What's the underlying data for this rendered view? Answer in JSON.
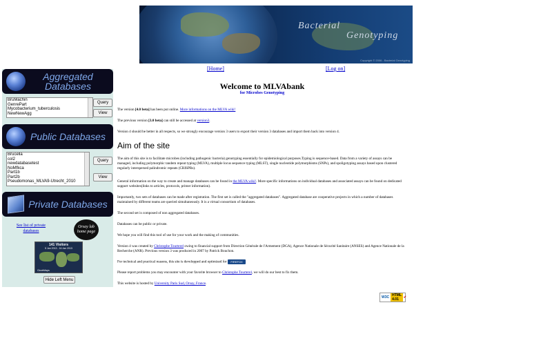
{
  "banner": {
    "word1": "Bacterial",
    "word2": "Genotyping",
    "copyright": "Copyright © 2006 - Bacterial Genotyping"
  },
  "nav": {
    "home": "[Home]",
    "login": "[Log on]"
  },
  "left_menu": {
    "aggregated": {
      "title": "Aggregated Databases",
      "items": [
        "BruMachin",
        "GenrePart",
        "Mycobacterium_tuberculosis",
        "NewNewAgg"
      ],
      "query_label": "Query",
      "view_label": "View"
    },
    "public": {
      "title": "Public Databases",
      "items": [
        "Brucella",
        "col2",
        "newdatabasetest",
        "NoMfkca",
        "Part1b",
        "Part2b",
        "Pseudomonas_MLVA9-Utrecht_2010"
      ],
      "query_label": "Query",
      "view_label": "View"
    },
    "private": {
      "title": "Private Databases",
      "see_list": "See list of private databases",
      "orsay_logo": "Orsay lab home page",
      "visitors_count": "141 Visitors",
      "visitors_dates": "5 Jan 2013 - 16 Jan 2013",
      "clustrmaps": "ClustrMaps"
    },
    "hide_label": "Hide Left Menu"
  },
  "main": {
    "title": "Welcome to MLVAbank",
    "subtitle": "for Microbes Genotyping",
    "p1_a": "The version ",
    "p1_bold": "[4.0 beta]",
    "p1_b": " has been put online. ",
    "p1_link": "More informations on the MLVA wiki!",
    "p2_a": "The previous version ",
    "p2_bold": "[3.0 beta]",
    "p2_b": " can still be accessed at ",
    "p2_link": "version3",
    "p2_c": ".",
    "p3": "Version 4 should be better in all respects, so we strongly encourage version 3 users to export their version 3 databases and import them back into version 4.",
    "aim_heading": "Aim of the site",
    "p4": "The aim of this site is to facilitate microbes (including pathogenic bacteria) genotyping essentially for epidemiological purposes.Typing is sequence-based. Data from a variety of assays can be managed, including polymorphic tandem repeat typing (MLVA), multiple locus sequence typing (MLST), single nucleotide polymorphisms (SNPs), and spoligotyping assays based upon clustered regularly interspersed palindromic repeats (CRISPRs).",
    "p5_a": "General information on the way to create and manage databases can be found in ",
    "p5_link": "the MLVA wiki!",
    "p5_b": ". More specific informations on individual databases and associated assays can be found on dedicated support websites(links to articles, protocols, primer information).",
    "p6": "Importantly, two sets of databases can be made after registration. The first set is called the \"aggregated databases\". Aggregated database are cooperative projects in which a number of databases maintained by different teams are queried simultaneously. It is a virtual consortium of databases.",
    "p7": "The second set is composed of non aggregated databases.",
    "p8": "Databases can be public or private.",
    "p9": "We hope you will find this tool of use for your work and the making of communities.",
    "p10_a": "Version 4 was created by ",
    "p10_link": "Christophe Tourterel",
    "p10_b": " owing to financial support from Direction Générale de l'Armement (DGA), Agence Nationale de Sécurité Sanitaire (ANSES) and Agence Nationale de la Recherche (ANR). Previous version 3 was produced in 2007 by Patrick Bouchon.",
    "p11": "For technical and practical reasons, this site is developped and optimized for ",
    "firefox_badge": "FIREFOX",
    "p12_a": "Please report problems you may encounter with your favorite browser to ",
    "p12_link": "Christophe Tourterel",
    "p12_b": ", we will do our best to fix them.",
    "p13_a": "This website is hosted by ",
    "p13_link": "University Paris Sud, Orsay, France",
    "p13_b": "."
  },
  "w3c_badge": {
    "w3c": "W3C",
    "html": "HTML 4.01"
  }
}
